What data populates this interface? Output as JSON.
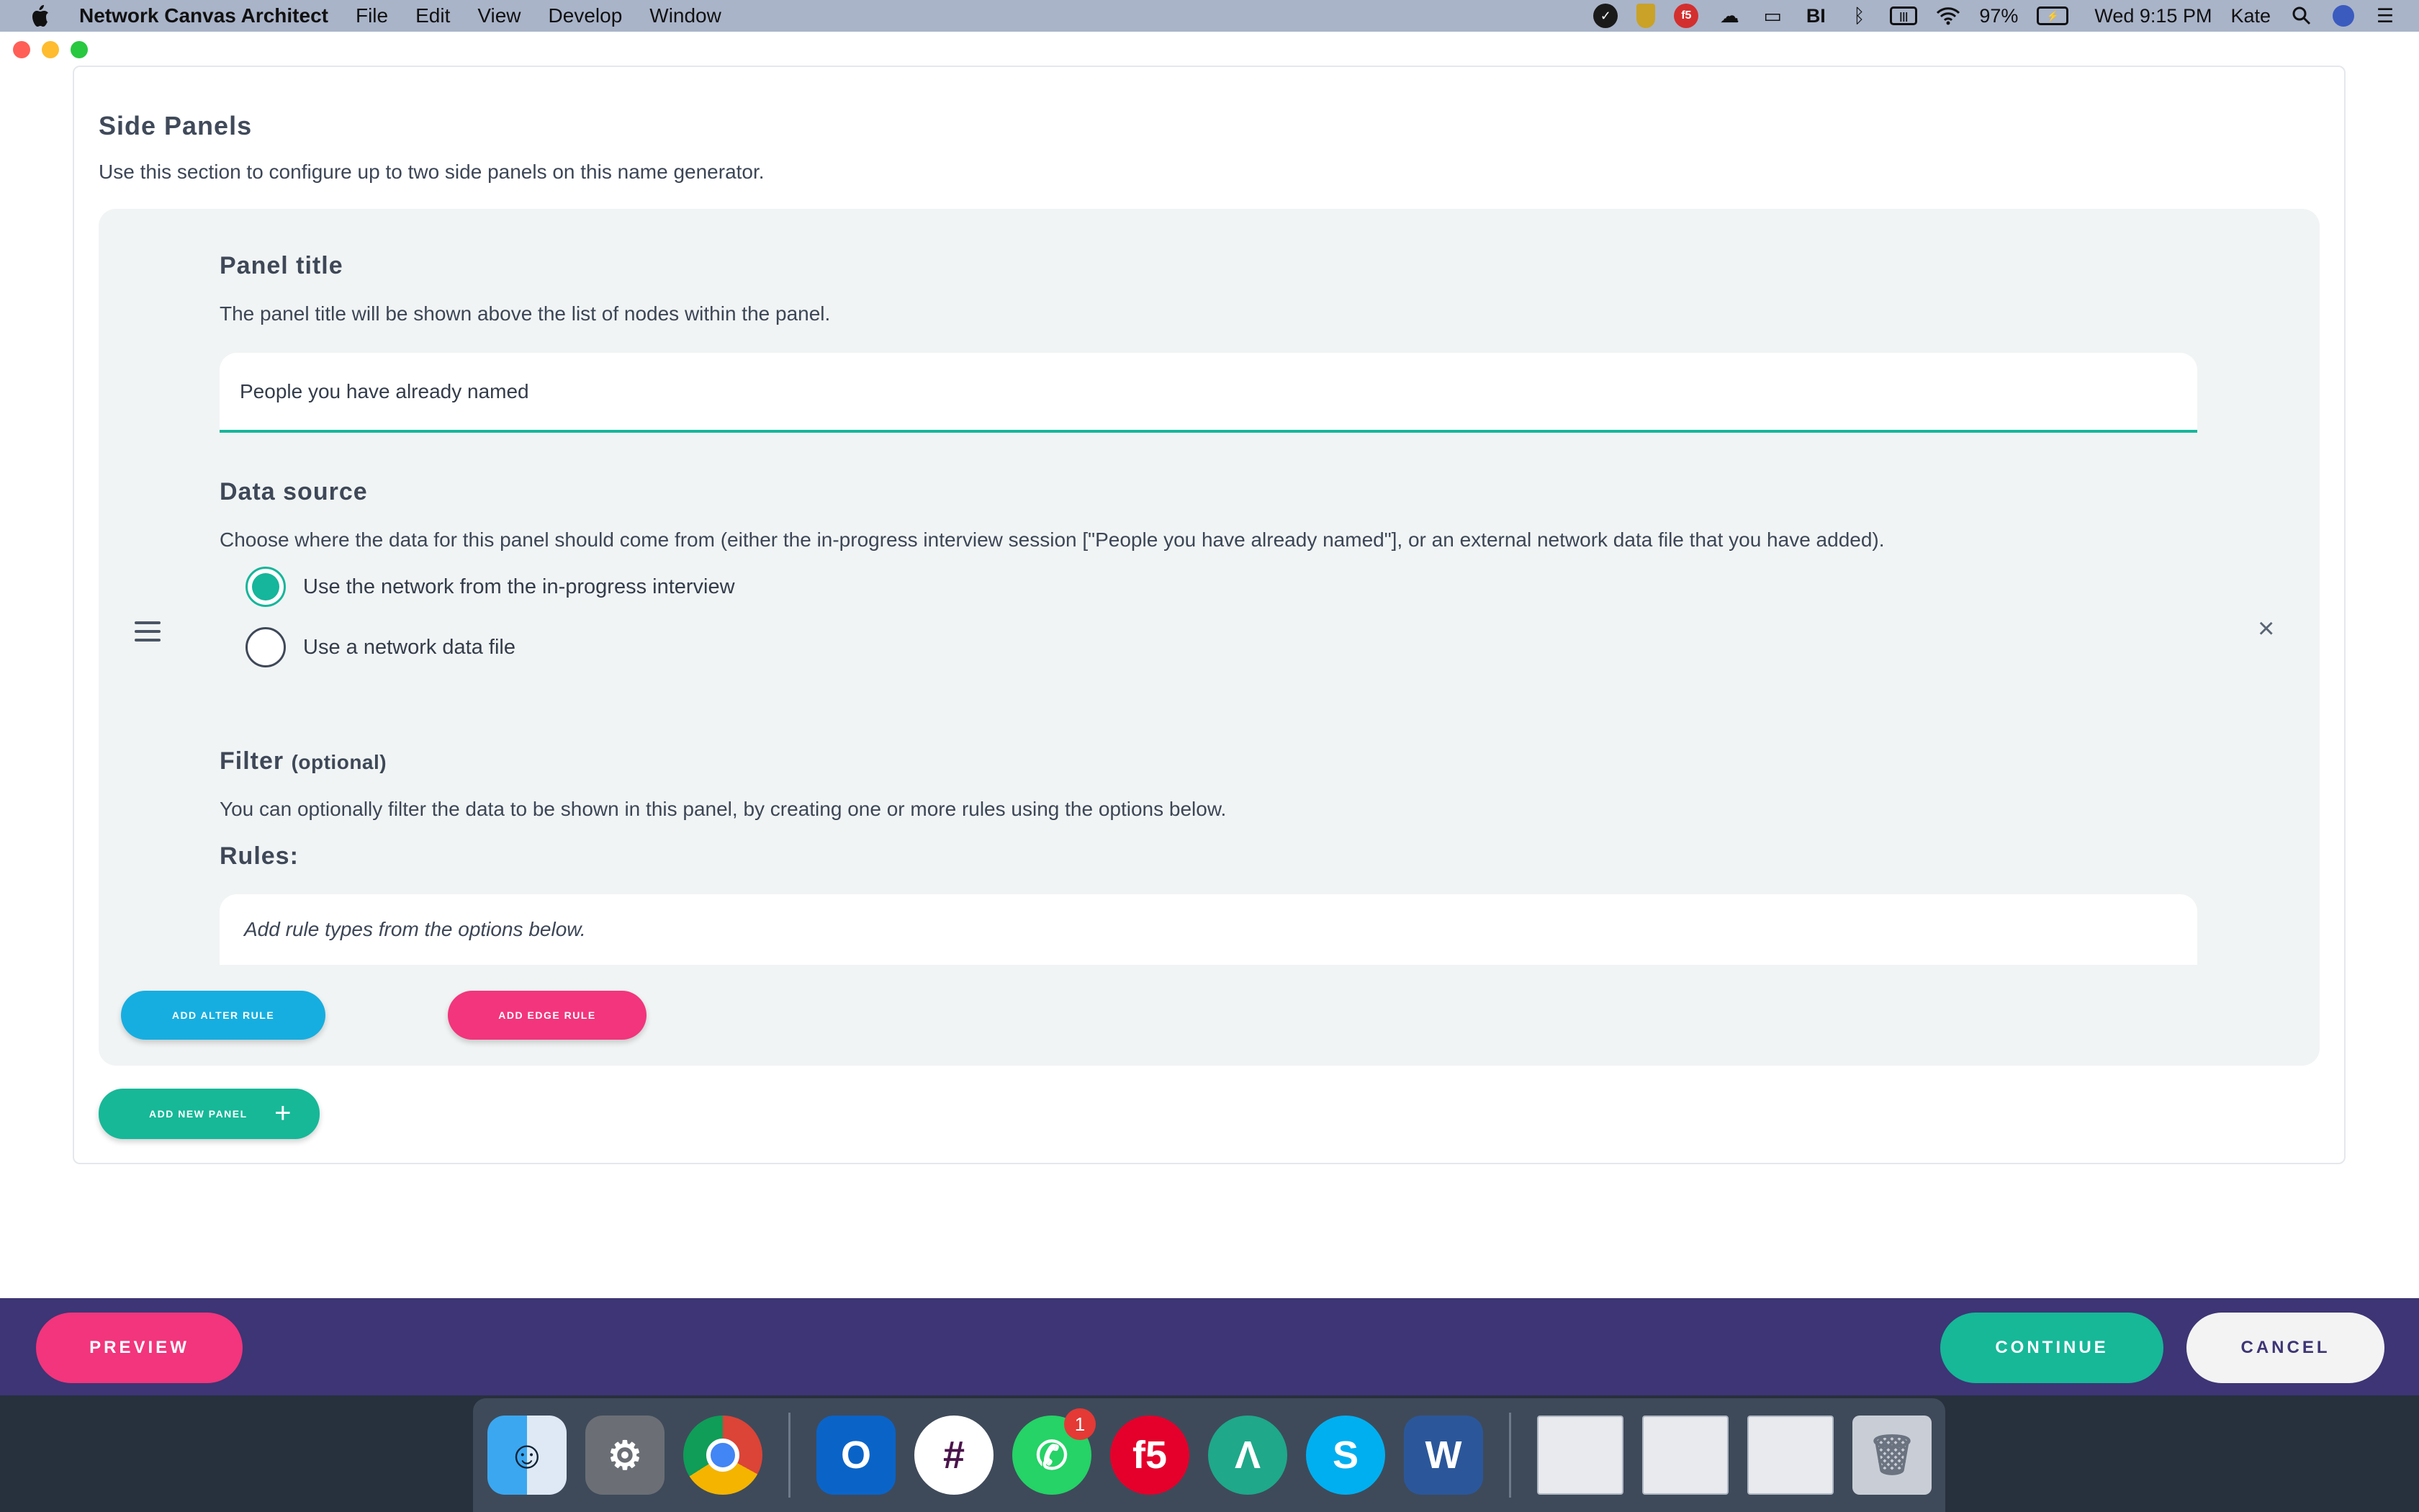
{
  "menubar": {
    "app_name": "Network Canvas Architect",
    "menus": [
      "File",
      "Edit",
      "View",
      "Develop",
      "Window"
    ],
    "battery": "97%",
    "clock": "Wed 9:15 PM",
    "user": "Kate",
    "status_icons": [
      "checkmark-icon",
      "shield-icon",
      "f5-icon",
      "cloud-icon",
      "airplay-icon",
      "bi-icon",
      "bluetooth-icon",
      "memory-icon",
      "wifi-icon",
      "battery-icon",
      "spotlight-icon",
      "siri-icon",
      "notification-center-icon"
    ]
  },
  "section": {
    "title": "Side Panels",
    "description": "Use this section to configure up to two side panels on this name generator."
  },
  "panel": {
    "title_label": "Panel title",
    "title_description": "The panel title will be shown above the list of nodes within the panel.",
    "title_value": "People you have already named",
    "data_source_label": "Data source",
    "data_source_description": "Choose where the data for this panel should come from (either the in-progress interview session [\"People you have already named\"], or an external network data file that you have added).",
    "data_source_options": [
      {
        "label": "Use the network from the in-progress interview",
        "checked": true
      },
      {
        "label": "Use a network data file",
        "checked": false
      }
    ],
    "filter_label": "Filter",
    "filter_optional": "(optional)",
    "filter_description": "You can optionally filter the data to be shown in this panel, by creating one or more rules using the options below.",
    "rules_label": "Rules:",
    "rules_placeholder": "Add rule types from the options below.",
    "add_alter_rule": "ADD ALTER RULE",
    "add_edge_rule": "ADD EDGE RULE",
    "remove_icon": "×",
    "accent_color": "#15b69b"
  },
  "add_new_panel": "ADD NEW PANEL",
  "footer": {
    "preview": "PREVIEW",
    "continue": "CONTINUE",
    "cancel": "CANCEL"
  },
  "dock": {
    "apps": [
      "Finder",
      "System Preferences",
      "Google Chrome",
      "Microsoft Outlook",
      "Slack",
      "WhatsApp",
      "F5 Access",
      "Network Canvas Architect",
      "Skype",
      "Microsoft Word"
    ],
    "whatsapp_badge": "1"
  }
}
